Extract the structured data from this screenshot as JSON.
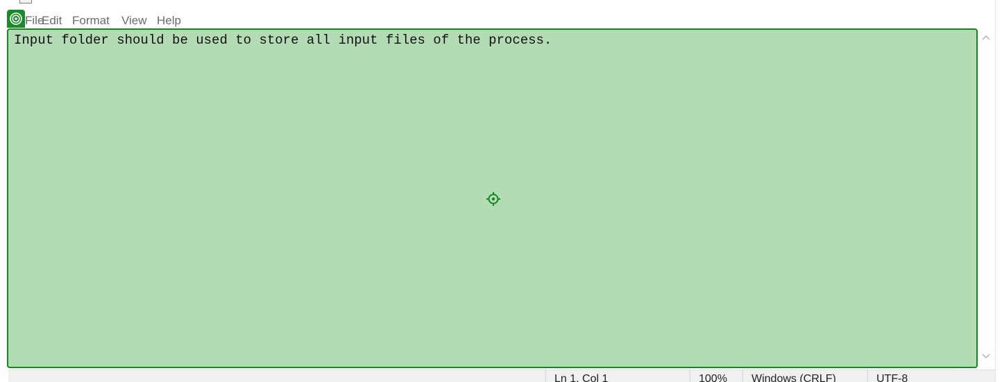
{
  "menu": {
    "file": "File",
    "edit": "Edit",
    "format": "Format",
    "view": "View",
    "help": "Help"
  },
  "editor": {
    "content": "Input folder should be used to store all input files of the process."
  },
  "status": {
    "position": "Ln 1, Col 1",
    "zoom": "100%",
    "line_ending": "Windows (CRLF)",
    "encoding": "UTF-8"
  },
  "colors": {
    "highlight_fill": "#b3dbb4",
    "highlight_border": "#0f8a1e"
  },
  "icons": {
    "app": "notepad-icon",
    "target": "target-icon",
    "crosshair": "crosshair-icon",
    "scroll_up": "chevron-up-icon",
    "scroll_down": "chevron-down-icon"
  }
}
